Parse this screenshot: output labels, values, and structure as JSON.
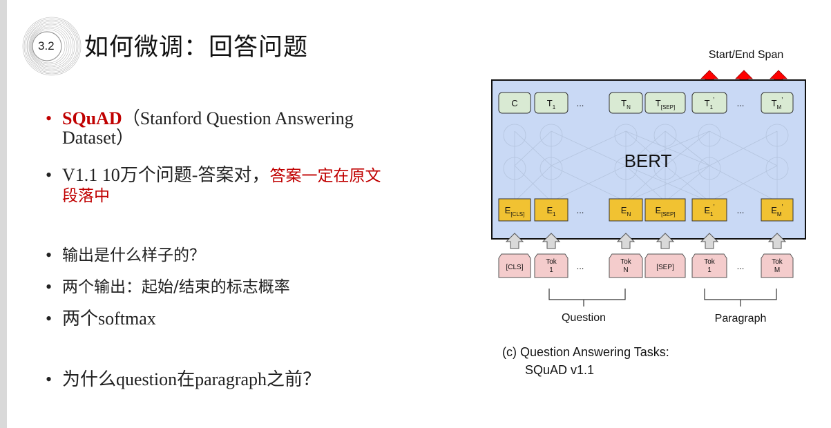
{
  "badge": {
    "number": "3.2"
  },
  "title": "如何微调：回答问题",
  "bullets": [
    {
      "highlight": "SQuAD",
      "text": "（Stanford Question Answering",
      "text2": "Dataset）"
    },
    {
      "text": "V1.1 10万个问题-答案对，",
      "red": "答案一定在原文",
      "red2": "段落中"
    },
    {
      "text": "输出是什么样子的？"
    },
    {
      "text": "两个输出：起始/结束的标志概率"
    },
    {
      "text": "两个softmax"
    },
    {
      "text": "为什么question在paragraph之前？"
    }
  ],
  "figure": {
    "span_label": "Start/End Span",
    "model_label": "BERT",
    "ellipsis": "...",
    "output_tokens": [
      {
        "base": "C",
        "sub": "",
        "sup": ""
      },
      {
        "base": "T",
        "sub": "1",
        "sup": ""
      },
      {
        "base": "T",
        "sub": "N",
        "sup": ""
      },
      {
        "base": "T",
        "sub": "[SEP]",
        "sup": ""
      },
      {
        "base": "T",
        "sub": "1",
        "sup": "’"
      },
      {
        "base": "T",
        "sub": "M",
        "sup": "’"
      }
    ],
    "embeddings": [
      {
        "base": "E",
        "sub": "[CLS]",
        "sup": ""
      },
      {
        "base": "E",
        "sub": "1",
        "sup": ""
      },
      {
        "base": "E",
        "sub": "N",
        "sup": ""
      },
      {
        "base": "E",
        "sub": "[SEP]",
        "sup": ""
      },
      {
        "base": "E",
        "sub": "1",
        "sup": "’"
      },
      {
        "base": "E",
        "sub": "M",
        "sup": "’"
      }
    ],
    "input_tokens": [
      {
        "line1": "[CLS]",
        "line2": ""
      },
      {
        "line1": "Tok",
        "line2": "1"
      },
      {
        "line1": "Tok",
        "line2": "N"
      },
      {
        "line1": "[SEP]",
        "line2": ""
      },
      {
        "line1": "Tok",
        "line2": "1"
      },
      {
        "line1": "Tok",
        "line2": "M"
      }
    ],
    "question_label": "Question",
    "paragraph_label": "Paragraph",
    "caption_line1": "(c) Question Answering Tasks:",
    "caption_line2": "SQuAD v1.1"
  },
  "colors": {
    "bert_box": "#c9d9f5",
    "output_box": "#d9ead3",
    "embedding_box": "#f1c232",
    "input_box": "#f4cccc",
    "arrow_red": "#ff0000",
    "highlight_red": "#c00000"
  }
}
